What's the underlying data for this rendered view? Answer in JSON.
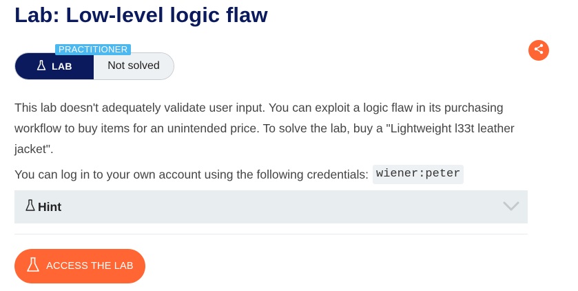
{
  "lab": {
    "title": "Lab: Low-level logic flaw",
    "level": "PRACTITIONER",
    "badge_label": "LAB",
    "status": "Not solved",
    "description": "This lab doesn't adequately validate user input. You can exploit a logic flaw in its purchasing workflow to buy items for an unintended price. To solve the lab, buy a \"Lightweight l33t leather jacket\".",
    "credentials_text": "You can log in to your own account using the following credentials:",
    "credentials_value": "wiener:peter",
    "hint_label": "Hint",
    "access_button": "ACCESS THE LAB"
  },
  "icons": {
    "share": "share-icon",
    "flask": "flask-icon",
    "chevron": "chevron-down-icon"
  },
  "colors": {
    "title": "#0a1a5c",
    "accent": "#ff6633",
    "level_tag": "#4bb8f0",
    "hint_bg": "#e8edf0"
  }
}
